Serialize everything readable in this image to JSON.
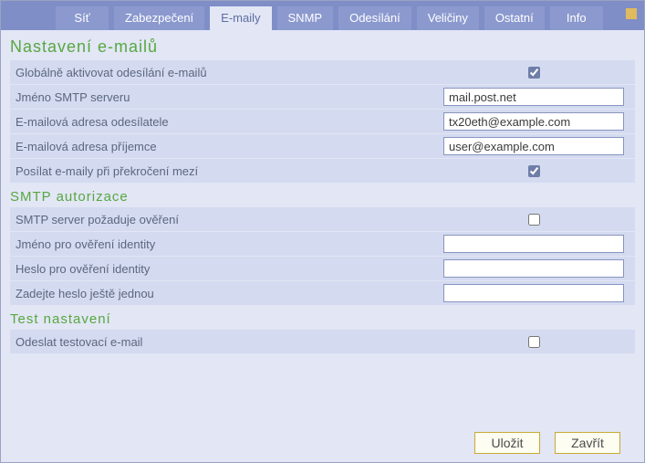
{
  "tabs": [
    {
      "label": "Síť",
      "active": false
    },
    {
      "label": "Zabezpečení",
      "active": false
    },
    {
      "label": "E-maily",
      "active": true
    },
    {
      "label": "SNMP",
      "active": false
    },
    {
      "label": "Odesílání",
      "active": false
    },
    {
      "label": "Veličiny",
      "active": false
    },
    {
      "label": "Ostatní",
      "active": false
    },
    {
      "label": "Info",
      "active": false
    }
  ],
  "section_main_title": "Nastavení e-mailů",
  "rows_main": [
    {
      "label": "Globálně aktivovat odesílání e-mailů",
      "type": "checkbox",
      "value": true
    },
    {
      "label": "Jméno SMTP serveru",
      "type": "text",
      "value": "mail.post.net"
    },
    {
      "label": "E-mailová adresa odesílatele",
      "type": "text",
      "value": "tx20eth@example.com"
    },
    {
      "label": "E-mailová adresa příjemce",
      "type": "text",
      "value": "user@example.com"
    },
    {
      "label": "Posílat e-maily při překročení mezí",
      "type": "checkbox",
      "value": true
    }
  ],
  "section_auth_title": "SMTP autorizace",
  "rows_auth": [
    {
      "label": "SMTP server požaduje ověření",
      "type": "checkbox",
      "value": false
    },
    {
      "label": "Jméno pro ověření identity",
      "type": "text",
      "value": ""
    },
    {
      "label": "Heslo pro ověření identity",
      "type": "text",
      "value": ""
    },
    {
      "label": "Zadejte heslo ještě jednou",
      "type": "text",
      "value": ""
    }
  ],
  "section_test_title": "Test nastavení",
  "rows_test": [
    {
      "label": "Odeslat testovací e-mail",
      "type": "checkbox",
      "value": false
    }
  ],
  "buttons": {
    "save": "Uložit",
    "close": "Zavřít"
  }
}
